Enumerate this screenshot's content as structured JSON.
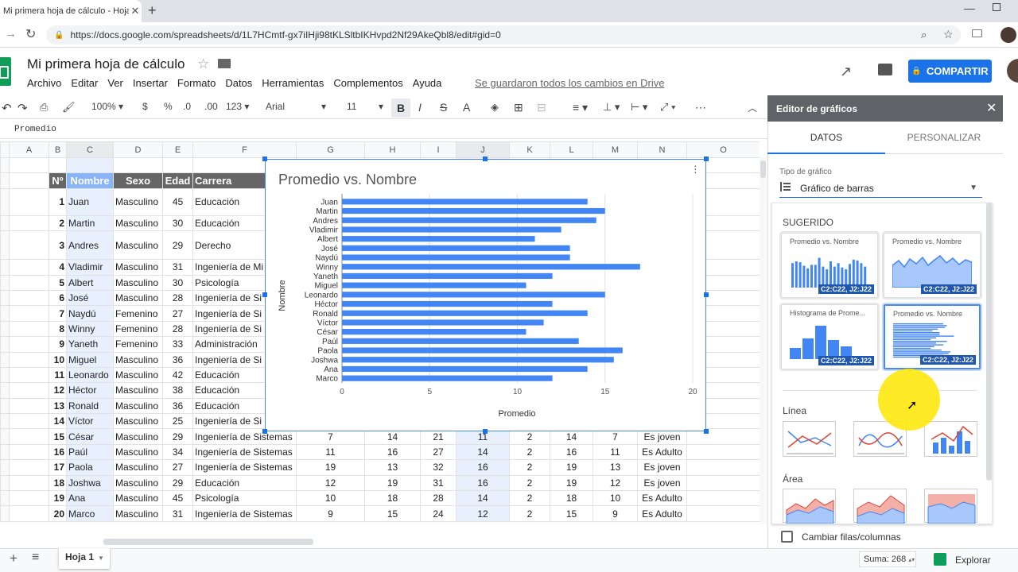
{
  "browser": {
    "tab_title": "Mi primera hoja de cálculo - Hoja",
    "url": "https://docs.google.com/spreadsheets/d/1L7HCmtf-gx7iIHji98tKLSltbIKHvpd2Nf29AkeQbl8/edit#gid=0"
  },
  "doc": {
    "title": "Mi primera hoja de cálculo",
    "menu": [
      "Archivo",
      "Editar",
      "Ver",
      "Insertar",
      "Formato",
      "Datos",
      "Herramientas",
      "Complementos",
      "Ayuda"
    ],
    "save_status": "Se guardaron todos los cambios en Drive",
    "share_label": "COMPARTIR"
  },
  "toolbar": {
    "zoom": "100%",
    "currency": "$",
    "percent": "%",
    "dec_less": ".0",
    "dec_more": ".00",
    "format": "123",
    "font": "Arial",
    "size": "11",
    "bold": "B",
    "italic": "I",
    "strike": "S",
    "textcolor": "A",
    "more": "⋯"
  },
  "formula": {
    "value": "Promedio"
  },
  "columns": [
    "A",
    "B",
    "C",
    "D",
    "E",
    "F",
    "G",
    "H",
    "I",
    "J",
    "K",
    "L",
    "M",
    "N",
    "O"
  ],
  "headers": {
    "n": "Nº",
    "nombre": "Nombre",
    "sexo": "Sexo",
    "edad": "Edad",
    "carrera": "Carrera"
  },
  "rows": [
    {
      "n": "1",
      "nombre": "Juan",
      "sexo": "Masculino",
      "edad": "45",
      "carrera": "Educación"
    },
    {
      "n": "2",
      "nombre": "Martin",
      "sexo": "Masculino",
      "edad": "30",
      "carrera": "Educación"
    },
    {
      "n": "3",
      "nombre": "Andres",
      "sexo": "Masculino",
      "edad": "29",
      "carrera": "Derecho"
    },
    {
      "n": "4",
      "nombre": "Vladimir",
      "sexo": "Masculino",
      "edad": "31",
      "carrera": "Ingeniería de Mi"
    },
    {
      "n": "5",
      "nombre": "Albert",
      "sexo": "Masculino",
      "edad": "30",
      "carrera": "Psicología"
    },
    {
      "n": "6",
      "nombre": "José",
      "sexo": "Masculino",
      "edad": "28",
      "carrera": "Ingeniería de Si"
    },
    {
      "n": "7",
      "nombre": "Naydú",
      "sexo": "Femenino",
      "edad": "27",
      "carrera": "Ingeniería de Si"
    },
    {
      "n": "8",
      "nombre": "Winny",
      "sexo": "Femenino",
      "edad": "28",
      "carrera": "Ingeniería de Si"
    },
    {
      "n": "9",
      "nombre": "Yaneth",
      "sexo": "Femenino",
      "edad": "33",
      "carrera": "Administración"
    },
    {
      "n": "10",
      "nombre": "Miguel",
      "sexo": "Masculino",
      "edad": "36",
      "carrera": "Ingeniería de Si"
    },
    {
      "n": "11",
      "nombre": "Leonardo",
      "sexo": "Masculino",
      "edad": "42",
      "carrera": "Educación"
    },
    {
      "n": "12",
      "nombre": "Héctor",
      "sexo": "Masculino",
      "edad": "38",
      "carrera": "Educación"
    },
    {
      "n": "13",
      "nombre": "Ronald",
      "sexo": "Masculino",
      "edad": "36",
      "carrera": "Educación"
    },
    {
      "n": "14",
      "nombre": "Víctor",
      "sexo": "Masculino",
      "edad": "25",
      "carrera": "Ingeniería de Si"
    },
    {
      "n": "15",
      "nombre": "César",
      "sexo": "Masculino",
      "edad": "29",
      "carrera": "Ingeniería de Sistemas",
      "g": "7",
      "h": "14",
      "i": "21",
      "j": "11",
      "k": "2",
      "l": "14",
      "m": "7",
      "res": "Es joven"
    },
    {
      "n": "16",
      "nombre": "Paúl",
      "sexo": "Masculino",
      "edad": "34",
      "carrera": "Ingeniería de Sistemas",
      "g": "11",
      "h": "16",
      "i": "27",
      "j": "14",
      "k": "2",
      "l": "16",
      "m": "11",
      "res": "Es Adulto"
    },
    {
      "n": "17",
      "nombre": "Paola",
      "sexo": "Masculino",
      "edad": "27",
      "carrera": "Ingeniería de Sistemas",
      "g": "19",
      "h": "13",
      "i": "32",
      "j": "16",
      "k": "2",
      "l": "19",
      "m": "13",
      "res": "Es joven"
    },
    {
      "n": "18",
      "nombre": "Joshwa",
      "sexo": "Masculino",
      "edad": "29",
      "carrera": "Educación",
      "g": "12",
      "h": "19",
      "i": "31",
      "j": "16",
      "k": "2",
      "l": "19",
      "m": "12",
      "res": "Es joven"
    },
    {
      "n": "19",
      "nombre": "Ana",
      "sexo": "Masculino",
      "edad": "45",
      "carrera": "Psicología",
      "g": "10",
      "h": "18",
      "i": "28",
      "j": "14",
      "k": "2",
      "l": "18",
      "m": "10",
      "res": "Es Adulto"
    },
    {
      "n": "20",
      "nombre": "Marco",
      "sexo": "Masculino",
      "edad": "31",
      "carrera": "Ingeniería de Sistemas",
      "g": "9",
      "h": "15",
      "i": "24",
      "j": "12",
      "k": "2",
      "l": "15",
      "m": "9",
      "res": "Es Adulto"
    }
  ],
  "chart_data": {
    "type": "bar",
    "orientation": "horizontal",
    "title": "Promedio vs. Nombre",
    "xlabel": "Promedio",
    "ylabel": "Nombre",
    "categories": [
      "Juan",
      "Martin",
      "Andres",
      "Vladimir",
      "Albert",
      "José",
      "Naydú",
      "Winny",
      "Yaneth",
      "Miguel",
      "Leonardo",
      "Héctor",
      "Ronald",
      "Víctor",
      "César",
      "Paúl",
      "Paola",
      "Joshwa",
      "Ana",
      "Marco"
    ],
    "values": [
      14,
      15,
      14.5,
      12.5,
      11,
      13,
      13,
      17,
      12,
      10.5,
      15,
      12,
      14,
      11.5,
      10.5,
      13.5,
      16,
      15.5,
      14,
      12
    ],
    "xlim": [
      0,
      20
    ],
    "xticks": [
      "0",
      "5",
      "10",
      "15",
      "20"
    ],
    "color": "#4285f4",
    "grid": true
  },
  "editor": {
    "title": "Editor de gráficos",
    "tab_datos": "DATOS",
    "tab_personalizar": "PERSONALIZAR",
    "tipo_label": "Tipo de gráfico",
    "tipo_value": "Gráfico de barras",
    "sugerido": "SUGERIDO",
    "cards": [
      {
        "title": "Promedio vs. Nombre",
        "range": "C2:C22, J2:J22"
      },
      {
        "title": "Promedio vs. Nombre",
        "range": "C2:C22, J2:J22"
      },
      {
        "title": "Histograma de Prome...",
        "range": "C2:C22, J2:J22"
      },
      {
        "title": "Promedio vs. Nombre",
        "range": "C2:C22, J2:J22"
      }
    ],
    "linea": "Línea",
    "area": "Área",
    "cambiar": "Cambiar filas/columnas"
  },
  "bottom": {
    "sheet": "Hoja 1",
    "sum": "Suma: 268",
    "explore": "Explorar"
  }
}
